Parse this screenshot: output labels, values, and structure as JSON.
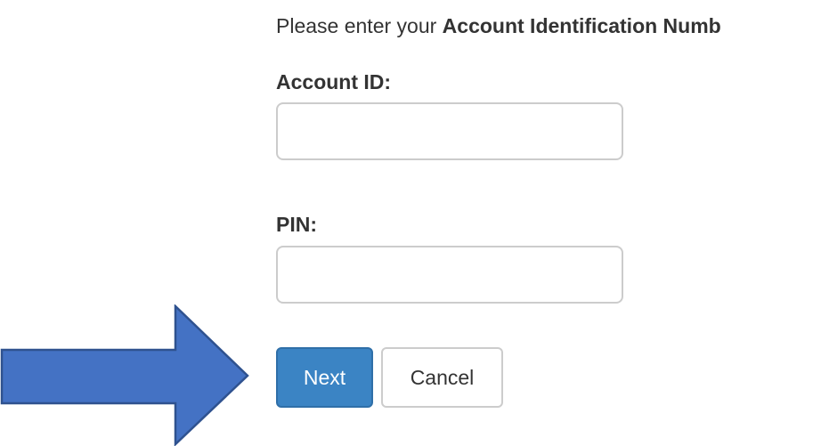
{
  "intro": {
    "prefix": "Please enter your ",
    "emphasis": "Account Identification Numb"
  },
  "form": {
    "account_id_label": "Account ID:",
    "account_id_value": "",
    "pin_label": "PIN:",
    "pin_value": ""
  },
  "buttons": {
    "next_label": "Next",
    "cancel_label": "Cancel"
  },
  "colors": {
    "primary_button": "#3b84c4",
    "arrow_fill": "#4472c4",
    "arrow_stroke": "#2f528f"
  },
  "icons": {
    "annotation_arrow": "right-arrow-icon"
  }
}
